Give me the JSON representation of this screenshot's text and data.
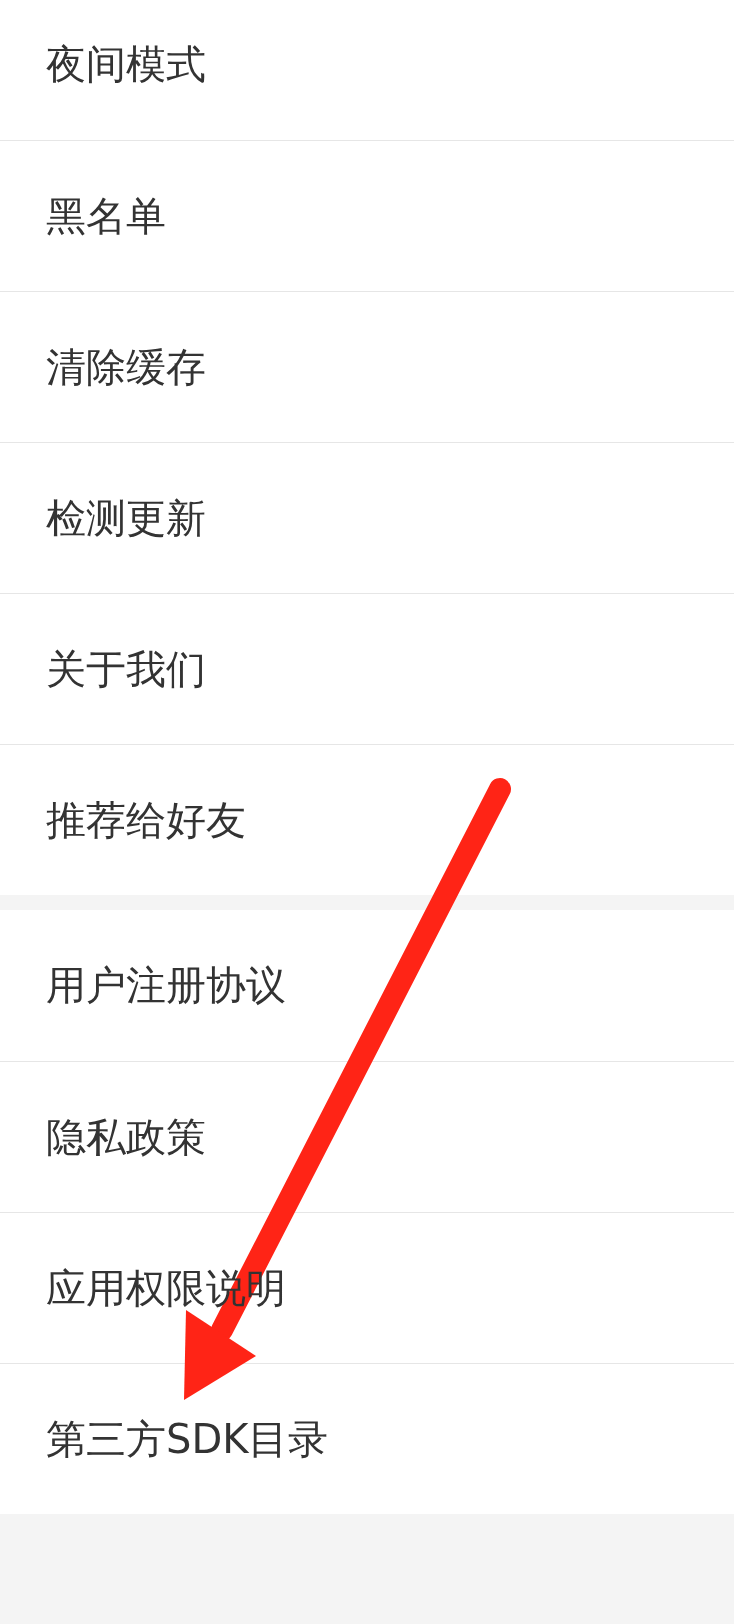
{
  "sections": [
    {
      "items": [
        {
          "label": "夜间模式"
        },
        {
          "label": "黑名单"
        },
        {
          "label": "清除缓存"
        },
        {
          "label": "检测更新"
        },
        {
          "label": "关于我们"
        },
        {
          "label": "推荐给好友"
        }
      ]
    },
    {
      "items": [
        {
          "label": "用户注册协议"
        },
        {
          "label": "隐私政策"
        },
        {
          "label": "应用权限说明"
        },
        {
          "label": "第三方SDK目录"
        }
      ]
    }
  ]
}
